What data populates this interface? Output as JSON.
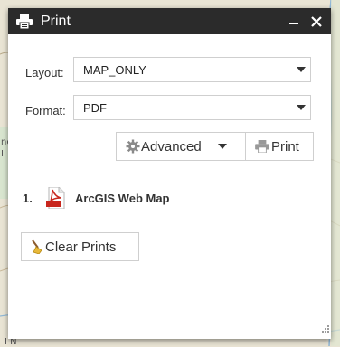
{
  "panel": {
    "title": "Print",
    "minimize_label": "–",
    "close_label": "✕"
  },
  "form": {
    "layout_label": "Layout:",
    "layout_value": "MAP_ONLY",
    "format_label": "Format:",
    "format_value": "PDF"
  },
  "actions": {
    "advanced_label": "Advanced",
    "print_label": "Print",
    "clear_label": "Clear Prints"
  },
  "results": [
    {
      "index": "1.",
      "title": "ArcGIS Web Map",
      "icon": "pdf-file-icon"
    }
  ],
  "map": {
    "fragment_left": "ne",
    "fragment_left2": "I",
    "fragment_bottom": "I N"
  },
  "colors": {
    "titlebar": "#2b2b2b",
    "pdf_red": "#c8261d",
    "map_bg": "#e9e4d4"
  }
}
